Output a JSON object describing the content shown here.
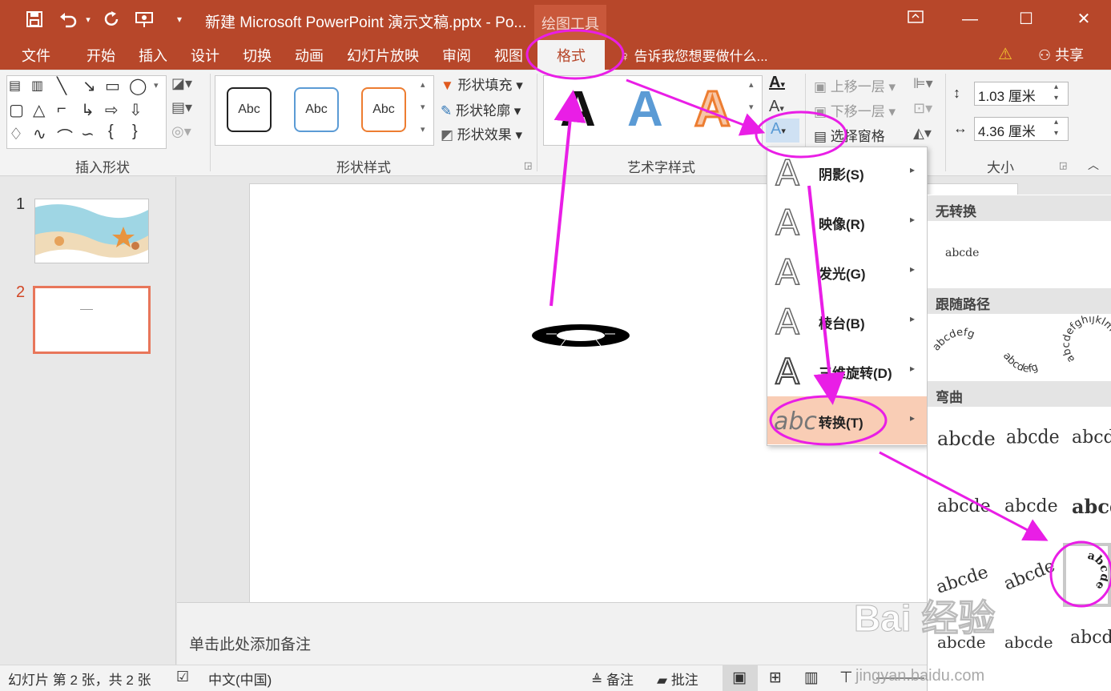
{
  "titlebar": {
    "title": "新建 Microsoft PowerPoint 演示文稿.pptx - Po...",
    "context_tab": "绘图工具"
  },
  "tabs": [
    "文件",
    "开始",
    "插入",
    "设计",
    "切换",
    "动画",
    "幻灯片放映",
    "审阅",
    "视图"
  ],
  "active_tab": "格式",
  "tell_me": "告诉我您想要做什么...",
  "share": "共享",
  "ribbon": {
    "insert_shapes_label": "插入形状",
    "shape_styles_label": "形状样式",
    "wordart_label": "艺术字样式",
    "size_label": "大小",
    "abc": "Abc",
    "shape_fill": "形状填充",
    "shape_outline": "形状轮廓",
    "shape_effects": "形状效果",
    "wordart_letter": "A",
    "bring_forward": "上移一层",
    "send_backward": "下移一层",
    "selection_pane": "选择窗格",
    "height": "1.03 厘米",
    "width": "4.36 厘米"
  },
  "slides": [
    {
      "number": "1"
    },
    {
      "number": "2"
    }
  ],
  "notes_placeholder": "单击此处添加备注",
  "status": {
    "slide_info": "幻灯片 第 2 张，共 2 张",
    "language": "中文(中国)",
    "notes": "备注",
    "comments": "批注"
  },
  "text_effects_menu": [
    {
      "label": "阴影(S)",
      "icon": "shadow-icon"
    },
    {
      "label": "映像(R)",
      "icon": "reflection-icon"
    },
    {
      "label": "发光(G)",
      "icon": "glow-icon"
    },
    {
      "label": "棱台(B)",
      "icon": "bevel-icon"
    },
    {
      "label": "三维旋转(D)",
      "icon": "3d-rotation-icon"
    },
    {
      "label": "转换(T)",
      "icon": "transform-icon"
    }
  ],
  "transform_gallery": {
    "no_transform": "无转换",
    "follow_path": "跟随路径",
    "warp": "弯曲",
    "sample": "abcde",
    "path_sample_1": "abcdefg",
    "path_sample_2": "abcdefg",
    "path_sample_3": "abcdefghijklm",
    "circle_sample": "abcde"
  },
  "watermark": {
    "brand": "Bai 经验",
    "url": "jingyan.baidu.com"
  },
  "colors": {
    "accent": "#b7472a",
    "highlight": "#f9cdb5",
    "annotation": "#e91ee6"
  }
}
